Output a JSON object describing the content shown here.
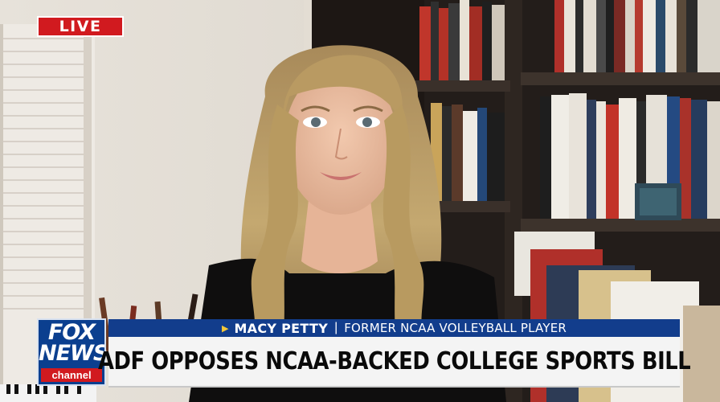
{
  "live_badge": {
    "label": "LIVE"
  },
  "network_logo": {
    "line1": "FOX",
    "line2": "NEWS",
    "line3": "channel"
  },
  "lower_third": {
    "name": "MACY PETTY",
    "title": "FORMER NCAA VOLLEYBALL PLAYER",
    "headline": "ADF OPPOSES NCAA-BACKED COLLEGE SPORTS BILL"
  },
  "colors": {
    "live_red": "#d11a1f",
    "name_bar_blue": "#123d8c",
    "headline_bar": "#f4f4f4",
    "logo_blue": "#0b3f8f",
    "arrow_gold": "#f3c73a"
  },
  "icons": {
    "name_bar_marker": "play-triangle-icon"
  }
}
